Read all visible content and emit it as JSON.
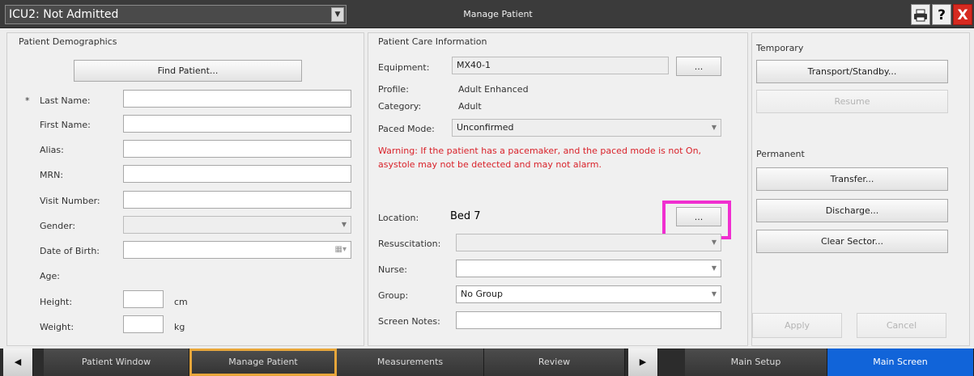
{
  "titlebar": {
    "bed_label": "ICU2: Not Admitted",
    "window_title": "Manage Patient",
    "icons": [
      "printer-icon",
      "help-icon",
      "close-icon"
    ],
    "help_glyph": "?",
    "close_glyph": "X"
  },
  "demographics": {
    "title": "Patient Demographics",
    "find_button": "Find Patient...",
    "required_marker": "*",
    "fields": [
      {
        "label": "Last Name:",
        "value": ""
      },
      {
        "label": "First Name:",
        "value": ""
      },
      {
        "label": "Alias:",
        "value": ""
      },
      {
        "label": "MRN:",
        "value": ""
      },
      {
        "label": "Visit Number:",
        "value": ""
      },
      {
        "label": "Gender:",
        "value": ""
      },
      {
        "label": "Date of Birth:",
        "value": ""
      }
    ],
    "age_label": "Age:",
    "height_label": "Height:",
    "height_unit": "cm",
    "height_value": "",
    "weight_label": "Weight:",
    "weight_unit": "kg",
    "weight_value": ""
  },
  "care": {
    "title": "Patient Care Information",
    "equipment_label": "Equipment:",
    "equipment_value": "MX40-1",
    "browse_label": "...",
    "profile_label": "Profile:",
    "profile_value": "Adult Enhanced",
    "category_label": "Category:",
    "category_value": "Adult",
    "paced_label": "Paced Mode:",
    "paced_value": "Unconfirmed",
    "warning": "Warning: If the patient has a pacemaker, and the paced mode is not On, asystole may not be detected and may not alarm.",
    "location_label": "Location:",
    "location_value": "Bed 7",
    "resus_label": "Resuscitation:",
    "resus_value": "",
    "nurse_label": "Nurse:",
    "nurse_value": "",
    "group_label": "Group:",
    "group_value": "No Group",
    "notes_label": "Screen Notes:",
    "notes_value": ""
  },
  "side": {
    "temporary_title": "Temporary",
    "transport_button": "Transport/Standby...",
    "resume_button": "Resume",
    "permanent_title": "Permanent",
    "transfer_button": "Transfer...",
    "discharge_button": "Discharge...",
    "clear_sector_button": "Clear Sector...",
    "apply_button": "Apply",
    "cancel_button": "Cancel"
  },
  "tabs": {
    "left_arrow": "◀",
    "right_arrow": "▶",
    "items": [
      "Patient Window",
      "Manage Patient",
      "Measurements",
      "Review",
      "Main Setup",
      "Main Screen"
    ]
  },
  "colors": {
    "highlight": "#f02fd0",
    "warning": "#d9222a",
    "active_tab_border": "#e7a63a",
    "main_screen_tab": "#1164d9"
  }
}
